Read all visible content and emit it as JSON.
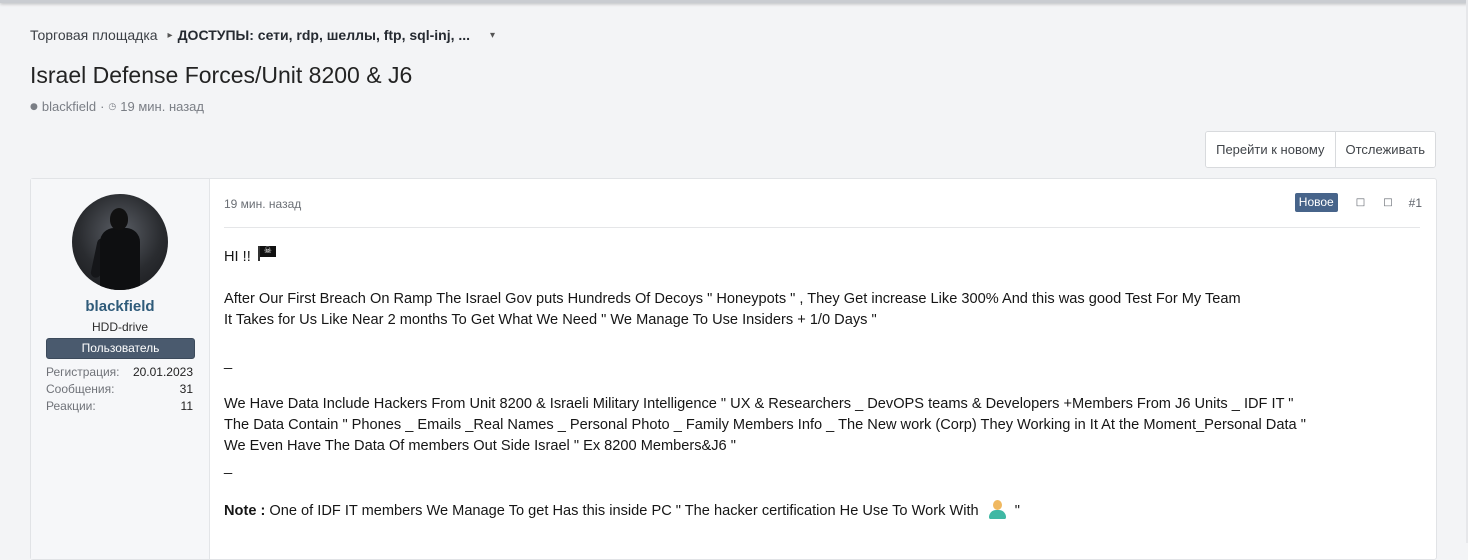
{
  "breadcrumb": {
    "parent": "Торговая площадка",
    "current": "ДОСТУПЫ: сети, rdp, шеллы, ftp, sql-inj, ..."
  },
  "thread": {
    "title": "Israel Defense Forces/Unit 8200 & J6",
    "author": "blackfield",
    "time": "19 мин. назад"
  },
  "actions": {
    "go_new": "Перейти к новому",
    "watch": "Отслеживать"
  },
  "user": {
    "name": "blackfield",
    "title": "HDD-drive",
    "banner": "Пользователь",
    "stats": [
      {
        "label": "Регистрация:",
        "value": "20.01.2023"
      },
      {
        "label": "Сообщения:",
        "value": "31"
      },
      {
        "label": "Реакции:",
        "value": "11"
      }
    ]
  },
  "post": {
    "date": "19 мин. назад",
    "badge": "Новое",
    "number": "#1",
    "greeting": "HI !!",
    "para1": [
      "After Our First Breach On Ramp The Israel Gov puts Hundreds Of Decoys \" Honeypots \" , They Get increase Like 300% And this was good Test For My Team",
      "It Takes for Us Like Near 2 months To Get What We Need \" We Manage To Use Insiders + 1/0 Days \""
    ],
    "sep1": "_",
    "para2": [
      "We Have Data Include Hackers From Unit 8200 & Israeli Military Intelligence \" UX & Researchers _ DevOPS teams & Developers +Members From J6 Units _ IDF IT \"",
      "The Data Contain \" Phones _ Emails _Real Names _ Personal Photo _ Family Members Info _ The New work (Corp) They Working in It At the Moment_Personal Data \"",
      "We Even Have The Data Of members Out Side Israel \" Ex 8200 Members&J6 \""
    ],
    "sep2": "_",
    "note_label": "Note :",
    "note_text": "One of IDF IT members We Manage To get Has this inside PC \" The hacker certification He Use To Work With",
    "note_end": "\""
  },
  "icons": {
    "breadcrumb_sep": "chevron-icon",
    "breadcrumb_menu": "dropdown-icon",
    "flag": "pirate-flag-icon",
    "emoji": "person-icon"
  }
}
